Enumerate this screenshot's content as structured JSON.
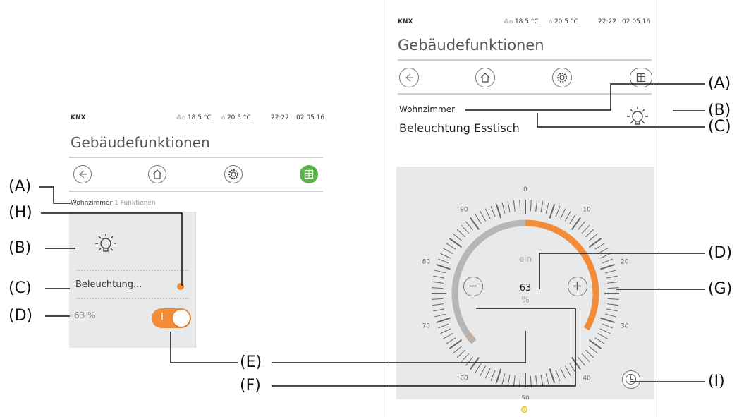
{
  "left_screen": {
    "status": {
      "brand": "KNX",
      "temp_outside": "18.5 °C",
      "temp_inside": "20.5 °C",
      "time": "22:22",
      "date": "02.05.16"
    },
    "title": "Gebäudefunktionen",
    "nav": [
      "back-icon",
      "home-icon",
      "settings-icon",
      "grid-icon"
    ],
    "breadcrumb_room": "Wohnzimmer",
    "breadcrumb_count": "1 Funktionen",
    "tile": {
      "name": "Beleuchtung...",
      "value": "63 %",
      "switch_label": "I",
      "state": "on"
    }
  },
  "right_screen": {
    "status": {
      "brand": "KNX",
      "temp_outside": "18.5 °C",
      "temp_inside": "20.5 °C",
      "time": "22:22",
      "date": "02.05.16"
    },
    "title": "Gebäudefunktionen",
    "room": "Wohnzimmer",
    "function_name": "Beleuchtung Esstisch",
    "dial": {
      "state_text": "ein",
      "value": "63",
      "unit": "%",
      "level": 63,
      "ticks": [
        "0",
        "10",
        "20",
        "30",
        "40",
        "50",
        "60",
        "70",
        "80",
        "90"
      ]
    }
  },
  "callouts": {
    "A": "(A)",
    "B": "(B)",
    "C": "(C)",
    "D": "(D)",
    "E": "(E)",
    "F": "(F)",
    "G": "(G)",
    "H": "(H)",
    "I": "(I)"
  },
  "colors": {
    "accent": "#f28c38",
    "active_nav": "#5bb24a",
    "panel": "#e8e9ea",
    "track": "#b5b6b8"
  }
}
